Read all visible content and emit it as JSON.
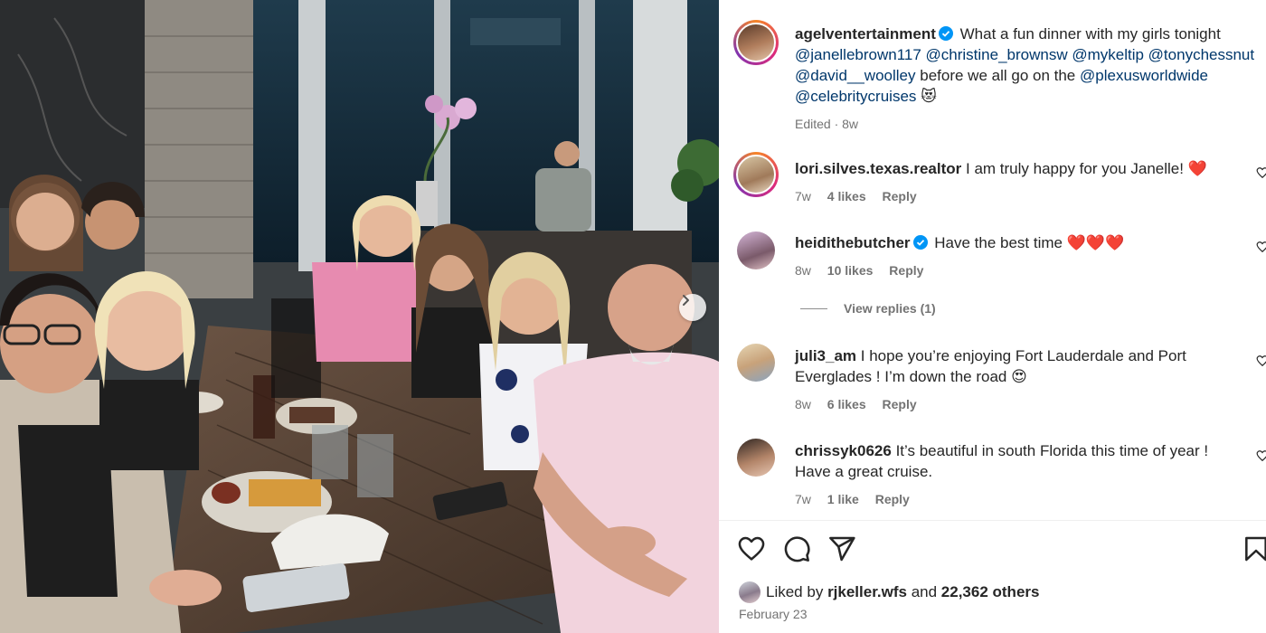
{
  "post": {
    "author": "agelventertainment",
    "caption_text": "What a fun dinner with my girls tonight",
    "mentions_line1": "@janellebrown117 @christine_brownsw @mykeltip @tonychessnut",
    "mention_david": "@david__woolley",
    "caption_mid": "before we all go on the",
    "mention_plexus": "@plexusworldwide",
    "mention_celebrity": "@celebritycruises",
    "emoji": "😻",
    "edited_meta": "Edited · 8w"
  },
  "comments": [
    {
      "username": "lori.silves.texas.realtor",
      "text": "I am truly happy for you Janelle! ❤️",
      "age": "7w",
      "likes": "4 likes",
      "reply": "Reply",
      "verified": false
    },
    {
      "username": "heidithebutcher",
      "text": "Have the best time ❤️❤️❤️",
      "age": "8w",
      "likes": "10 likes",
      "reply": "Reply",
      "verified": true
    },
    {
      "username": "juli3_am",
      "text": "I hope you’re enjoying Fort Lauderdale and Port Everglades ! I’m down the road 😍",
      "age": "8w",
      "likes": "6 likes",
      "reply": "Reply",
      "verified": false
    },
    {
      "username": "chrissyk0626",
      "text": "It’s beautiful in south Florida this time of year ! Have a great cruise.",
      "age": "7w",
      "likes": "1 like",
      "reply": "Reply",
      "verified": false
    }
  ],
  "view_replies": "View replies (1)",
  "likes_summary": {
    "prefix": "Liked by",
    "user": "rjkeller.wfs",
    "and": "and",
    "others": "22,362 others"
  },
  "post_date": "February 23",
  "icons": {
    "like": "heart-icon",
    "comment": "comment-icon",
    "share": "send-icon",
    "save": "bookmark-icon",
    "carousel_next": "chevron-right-icon"
  },
  "colors": {
    "mention": "#00376b",
    "verified": "#0095f6",
    "muted": "#737373",
    "heart": "#ed4956"
  }
}
